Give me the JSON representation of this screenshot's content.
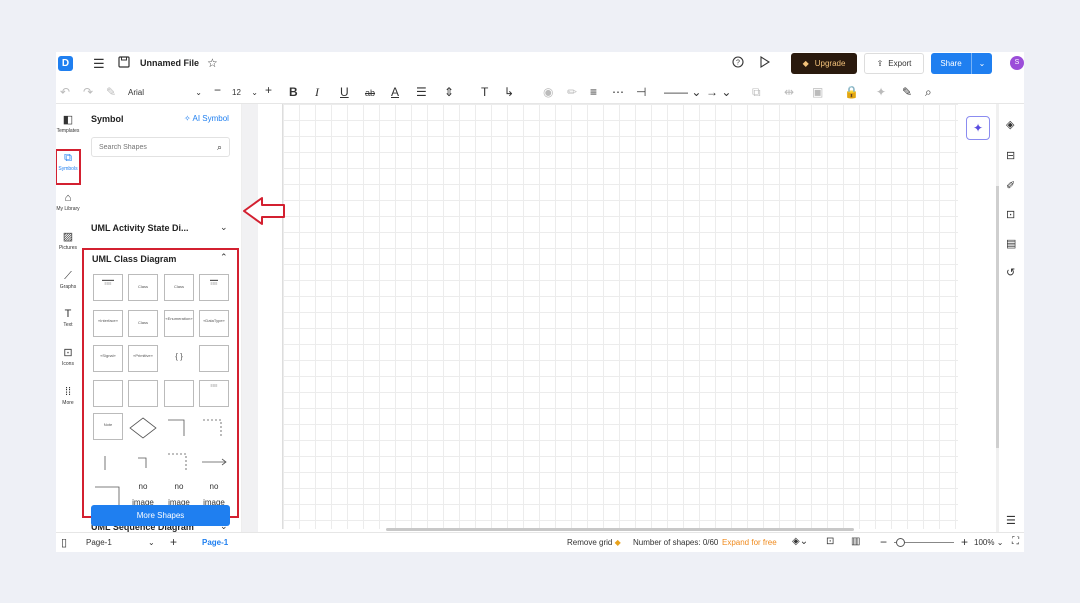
{
  "header": {
    "logo_glyph": "D",
    "file_name": "Unnamed File",
    "upgrade_label": "Upgrade",
    "export_label": "Export",
    "share_label": "Share",
    "avatar_initial": "S"
  },
  "toolbar": {
    "font_family": "Arial",
    "font_size": "12"
  },
  "rail": {
    "items": [
      {
        "label": "Templates",
        "icon": "templates-icon"
      },
      {
        "label": "Symbols",
        "icon": "symbols-icon"
      },
      {
        "label": "My Library",
        "icon": "library-icon"
      },
      {
        "label": "Pictures",
        "icon": "pictures-icon"
      },
      {
        "label": "Graphs",
        "icon": "graphs-icon"
      },
      {
        "label": "Text",
        "icon": "text-icon"
      },
      {
        "label": "Icons",
        "icon": "icons-icon"
      },
      {
        "label": "More",
        "icon": "more-icon"
      }
    ]
  },
  "panel": {
    "title": "Symbol",
    "ai_symbol": "AI Symbol",
    "search_placeholder": "Search Shapes",
    "sections": [
      {
        "label": "UML Activity State Di...",
        "expanded": false
      },
      {
        "label": "UML Class Diagram",
        "expanded": true
      },
      {
        "label": "UML Sequence Diagram",
        "expanded": false
      }
    ],
    "no_image_label": "no image",
    "more_shapes_label": "More Shapes"
  },
  "status": {
    "page_selector": "Page-1",
    "page_tab": "Page-1",
    "remove_grid": "Remove grid",
    "shape_count": "Number of shapes: 0/60",
    "expand_label": "Expand for free",
    "zoom": "100%"
  },
  "colors": {
    "accent": "#1f7ff0",
    "highlight": "#d32030",
    "upgrade_bg": "#2a1a0e",
    "expand_text": "#f08a1c"
  }
}
